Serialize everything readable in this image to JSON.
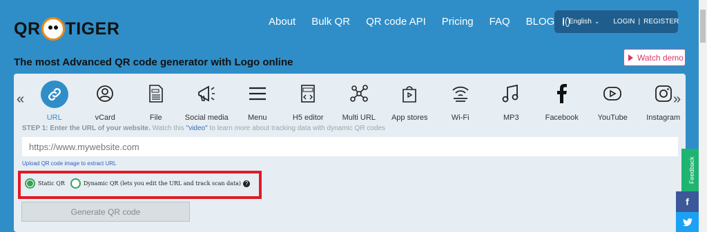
{
  "header": {
    "logo_left": "QR",
    "logo_right": "TIGER",
    "nav": [
      "About",
      "Bulk QR",
      "QR code API",
      "Pricing",
      "FAQ",
      "BLOG"
    ],
    "language": "English",
    "login": "LOGIN",
    "separator": "|",
    "register": "REGISTER"
  },
  "page_title": "The most Advanced QR code generator with Logo online",
  "watch_demo": "Watch demo",
  "nav_arrows": {
    "left": "«",
    "right": "»"
  },
  "types": [
    {
      "label": "URL",
      "icon": "link-icon",
      "active": true
    },
    {
      "label": "vCard",
      "icon": "user-icon"
    },
    {
      "label": "File",
      "icon": "file-icon"
    },
    {
      "label": "Social media",
      "icon": "megaphone-icon"
    },
    {
      "label": "Menu",
      "icon": "menu-icon"
    },
    {
      "label": "H5 editor",
      "icon": "html-icon"
    },
    {
      "label": "Multi URL",
      "icon": "multi-url-icon"
    },
    {
      "label": "App stores",
      "icon": "app-store-icon"
    },
    {
      "label": "Wi-Fi",
      "icon": "wifi-icon"
    },
    {
      "label": "MP3",
      "icon": "music-icon"
    },
    {
      "label": "Facebook",
      "icon": "facebook-icon"
    },
    {
      "label": "YouTube",
      "icon": "youtube-icon"
    },
    {
      "label": "Instagram",
      "icon": "instagram-icon"
    }
  ],
  "step": {
    "bold": "STEP 1: Enter the URL of your website.",
    "pre": " Watch this ",
    "link": "\"video\"",
    "post": " to learn more about tracking data with dynamic QR codes"
  },
  "url_placeholder": "https://www.mywebsite.com",
  "upload_link": "Upload QR code image to extract URL",
  "radios": {
    "static": "Static QR",
    "dynamic": "Dynamic QR (lets you edit the URL and track scan data)",
    "help": "?"
  },
  "generate_button": "Generate QR code",
  "feedback": "Feedback",
  "facebook_side": "f",
  "colors": {
    "primary": "#2f8ec8",
    "panel": "#e6edf3",
    "highlight": "#e01b24",
    "green": "#3aa05a"
  }
}
